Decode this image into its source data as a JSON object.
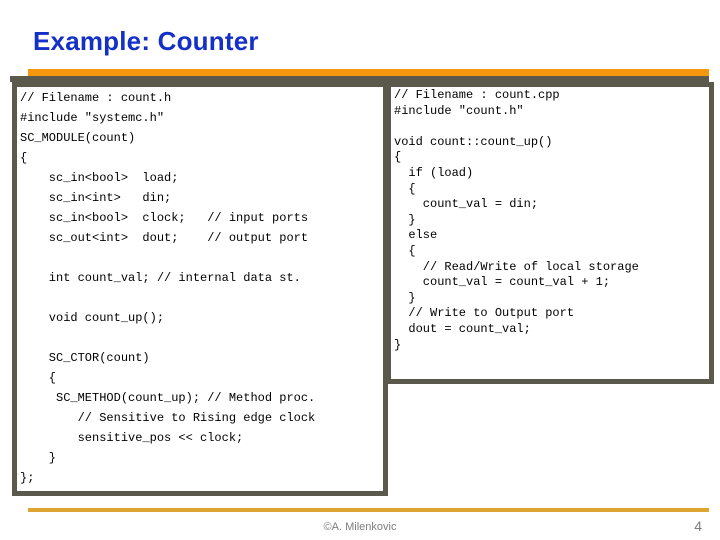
{
  "slide": {
    "title": "Example: Counter",
    "title_color": "#1430c6",
    "accent_color": "#f6970d",
    "border_color": "#5b584c"
  },
  "code_blocks": {
    "header_file": {
      "name": "count.h",
      "text": "// Filename : count.h\n#include \"systemc.h\"\nSC_MODULE(count)\n{\n    sc_in<bool>  load;\n    sc_in<int>   din;\n    sc_in<bool>  clock;   // input ports\n    sc_out<int>  dout;    // output port\n\n    int count_val; // internal data st.\n\n    void count_up();\n\n    SC_CTOR(count)\n    {\n     SC_METHOD(count_up); // Method proc.\n        // Sensitive to Rising edge clock\n        sensitive_pos << clock;\n    }\n};"
    },
    "source_file": {
      "name": "count.cpp",
      "text": "// Filename : count.cpp\n#include \"count.h\"\n\nvoid count::count_up()\n{\n  if (load)\n  {\n    count_val = din;\n  }\n  else\n  {\n    // Read/Write of local storage\n    count_val = count_val + 1;\n  }\n  // Write to Output port\n  dout = count_val;\n}"
    }
  },
  "footer": {
    "credit": "©A. Milenkovic",
    "page_number": "4"
  }
}
